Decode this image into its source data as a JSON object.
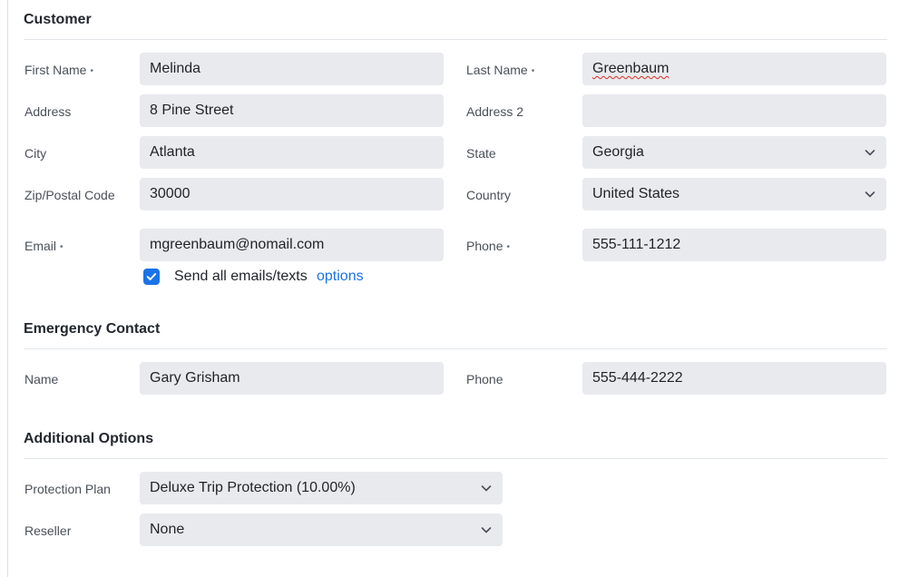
{
  "sections": {
    "customer": "Customer",
    "emergency": "Emergency Contact",
    "additional": "Additional Options"
  },
  "customer": {
    "first_name": {
      "label": "First Name",
      "required_mark": "•",
      "value": "Melinda"
    },
    "last_name": {
      "label": "Last Name",
      "required_mark": "•",
      "value": "Greenbaum"
    },
    "address": {
      "label": "Address",
      "value": "8 Pine Street"
    },
    "address2": {
      "label": "Address 2",
      "value": ""
    },
    "city": {
      "label": "City",
      "value": "Atlanta"
    },
    "state": {
      "label": "State",
      "value": "Georgia"
    },
    "zip": {
      "label": "Zip/Postal Code",
      "value": "30000"
    },
    "country": {
      "label": "Country",
      "value": "United States"
    },
    "email": {
      "label": "Email",
      "required_mark": "•",
      "value": "mgreenbaum@nomail.com"
    },
    "phone": {
      "label": "Phone",
      "required_mark": "•",
      "value": "555-111-1212"
    },
    "send_all": {
      "label": "Send all emails/texts",
      "checked": true,
      "link": "options"
    }
  },
  "emergency": {
    "name": {
      "label": "Name",
      "value": "Gary Grisham"
    },
    "phone": {
      "label": "Phone",
      "value": "555-444-2222"
    }
  },
  "additional": {
    "protection_plan": {
      "label": "Protection Plan",
      "value": "Deluxe Trip Protection (10.00%)"
    },
    "reseller": {
      "label": "Reseller",
      "value": "None"
    }
  },
  "colors": {
    "accent": "#1a73e8",
    "field_bg": "#e8eaee"
  }
}
